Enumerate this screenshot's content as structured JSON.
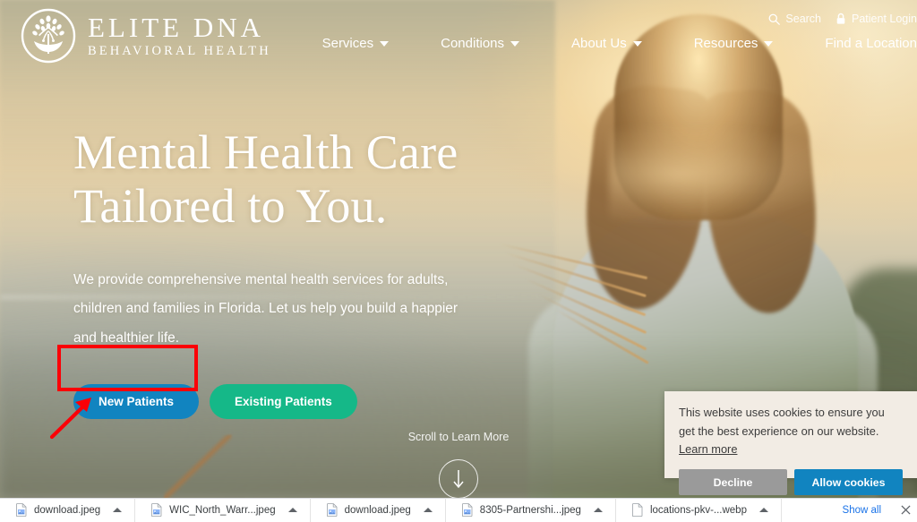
{
  "site": {
    "logo": {
      "icon": "tree-circle-logo-icon",
      "line1": "ELITE DNA",
      "line2": "BEHAVIORAL HEALTH"
    },
    "utility_nav": [
      {
        "label": "Search",
        "icon": "search-icon"
      },
      {
        "label": "Patient Login",
        "icon": "lock-icon"
      }
    ],
    "main_nav": [
      {
        "label": "Services",
        "has_dropdown": true
      },
      {
        "label": "Conditions",
        "has_dropdown": true
      },
      {
        "label": "About Us",
        "has_dropdown": true
      },
      {
        "label": "Resources",
        "has_dropdown": true
      },
      {
        "label": "Find a Location",
        "has_dropdown": false
      }
    ]
  },
  "hero": {
    "heading_line1": "Mental Health Care",
    "heading_line2": "Tailored to You.",
    "paragraph": "We provide comprehensive mental health services for adults, children and families in Florida. Let us help you build a happier and healthier life.",
    "primary_button": "New Patients",
    "secondary_button": "Existing Patients",
    "primary_color": "#1184c0",
    "secondary_color": "#15b888",
    "scroll_label": "Scroll to Learn More",
    "scroll_icon": "arrow-down-circle-icon"
  },
  "annotation": {
    "highlight_color": "#fb0007",
    "target": "New Patients"
  },
  "cookie_banner": {
    "message": "This website uses cookies to ensure you get the best experience on our website.",
    "learn_more": "Learn more",
    "decline_label": "Decline",
    "allow_label": "Allow cookies",
    "decline_color": "#9a9a9a",
    "allow_color": "#1184c0"
  },
  "download_shelf": {
    "items": [
      {
        "name": "download.jpeg",
        "icon": "image-file-icon"
      },
      {
        "name": "WIC_North_Warr...jpeg",
        "icon": "image-file-icon"
      },
      {
        "name": "download.jpeg",
        "icon": "image-file-icon"
      },
      {
        "name": "8305-Partnershi...jpeg",
        "icon": "image-file-icon"
      },
      {
        "name": "locations-pkv-...webp",
        "icon": "generic-file-icon"
      }
    ],
    "show_all": "Show all",
    "close_icon": "close-icon"
  }
}
